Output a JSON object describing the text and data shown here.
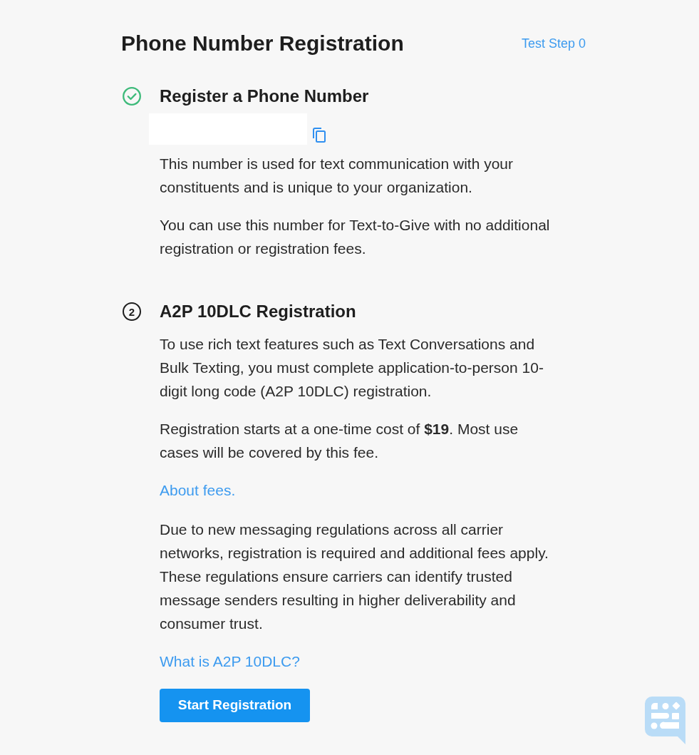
{
  "header": {
    "title": "Phone Number Registration",
    "test_link": "Test Step 0"
  },
  "steps": [
    {
      "completed": true,
      "title": "Register a Phone Number",
      "blocks": [
        {
          "kind": "number_field"
        },
        {
          "kind": "paragraph",
          "text": "This number is used for text communication with your constituents and is unique to your organization."
        },
        {
          "kind": "paragraph",
          "text": "You can use this number for Text-to-Give with no additional registration or registration fees."
        }
      ]
    },
    {
      "completed": false,
      "number": "2",
      "title": "A2P 10DLC Registration",
      "blocks": [
        {
          "kind": "paragraph",
          "text": "To use rich text features such as Text Conversations and Bulk Texting, you must complete application-to-person 10-digit long code (A2P 10DLC) registration."
        },
        {
          "kind": "paragraph",
          "text": "Registration starts at a one-time cost of **$19**. Most use cases will be covered by this fee."
        },
        {
          "kind": "link",
          "text": "About fees."
        },
        {
          "kind": "paragraph",
          "text": "Due to new messaging regulations across all carrier networks, registration is required and additional fees apply. These regulations ensure carriers can identify trusted message senders resulting in higher deliverability and consumer trust."
        },
        {
          "kind": "link",
          "text": "What is A2P 10DLC?"
        },
        {
          "kind": "button",
          "text": "Start Registration"
        }
      ]
    }
  ]
}
